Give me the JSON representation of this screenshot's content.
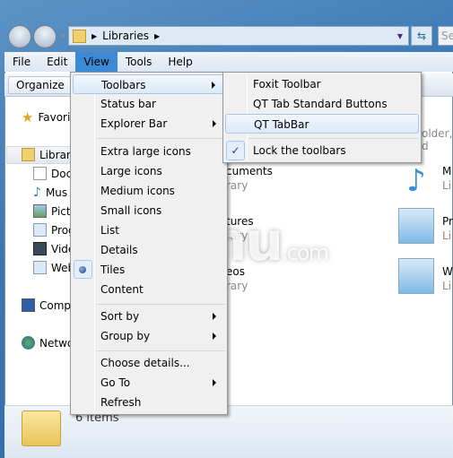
{
  "address": {
    "path": "Libraries",
    "search_placeholder": "Se"
  },
  "menubar": [
    "File",
    "Edit",
    "View",
    "Tools",
    "Help"
  ],
  "toolbar": {
    "organize": "Organize"
  },
  "nav": {
    "favorites": "Favori",
    "libraries": "Librar",
    "lib_items": [
      "Doc",
      "Mus",
      "Pict",
      "Prog",
      "Vide",
      "Web"
    ],
    "computer": "Comp",
    "network": "Netwo"
  },
  "content": {
    "header_fragment": "older, d",
    "tiles_left": [
      {
        "name": "cuments",
        "sub": "rary"
      },
      {
        "name": "tures",
        "sub": "rary"
      },
      {
        "name": "eos",
        "sub": "rary"
      }
    ],
    "tiles_right": [
      {
        "name": "M",
        "sub": "Lib"
      },
      {
        "name": "Pr",
        "sub": "Lib"
      },
      {
        "name": "W",
        "sub": "Lib"
      }
    ]
  },
  "view_menu": {
    "items": [
      "Toolbars",
      "Status bar",
      "Explorer Bar",
      "Extra large icons",
      "Large icons",
      "Medium icons",
      "Small icons",
      "List",
      "Details",
      "Tiles",
      "Content",
      "Sort by",
      "Group by",
      "Choose details...",
      "Go To",
      "Refresh"
    ],
    "selected": "Tiles",
    "highlighted": "Toolbars"
  },
  "toolbars_submenu": {
    "items": [
      "Foxit Toolbar",
      "QT Tab Standard Buttons",
      "QT TabBar",
      "Lock the toolbars"
    ],
    "checked": "Lock the toolbars",
    "highlighted": "QT TabBar"
  },
  "status": {
    "count": "6 items"
  },
  "watermark": {
    "text": "inimu",
    "suffix": ".com"
  }
}
